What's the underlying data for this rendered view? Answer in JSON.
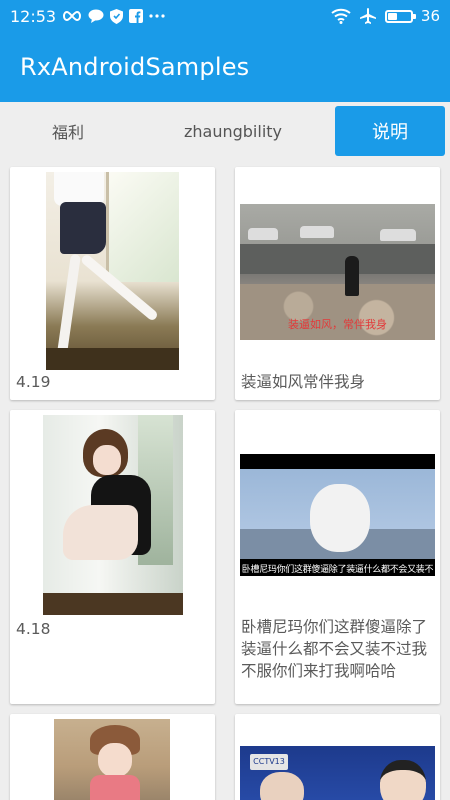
{
  "status_bar": {
    "time": "12:53",
    "battery": "36",
    "battery_level": 0.36,
    "left_icons": [
      "infinity-icon",
      "chat-bubble-icon",
      "shield-icon",
      "facebook-icon",
      "more-dots-icon"
    ],
    "right_icons": [
      "wifi-icon",
      "airplane-icon",
      "battery-icon"
    ]
  },
  "app_bar": {
    "title": "RxAndroidSamples",
    "background": "#1a9be8"
  },
  "tabs": [
    {
      "label": "福利",
      "selected": false
    },
    {
      "label": "zhaungbility",
      "selected": false
    },
    {
      "label": "说明",
      "selected": true
    }
  ],
  "cards": [
    {
      "caption": "4.19",
      "image": "photo-girl-skirt"
    },
    {
      "caption": "装逼如风常伴我身",
      "image": "photo-street-gif",
      "image_caption": "装逼如风，常伴我身"
    },
    {
      "caption": "4.18",
      "image": "photo-girl-sitting"
    },
    {
      "caption": "卧槽尼玛你们这群傻逼除了装逼什么都不会又装不过我不服你们来打我啊哈哈",
      "image": "photo-meme",
      "image_caption": "卧槽尼玛你们这群傻逼除了装逼什么都不会又装不过我不服你们来打我啊哈哈"
    },
    {
      "caption": "",
      "image": "photo-girl-pink"
    },
    {
      "caption": "",
      "image": "photo-tv-broadcast",
      "image_caption": "CCTV13"
    }
  ],
  "colors": {
    "primary": "#1a9be8",
    "background": "#eeeeee",
    "card": "#ffffff",
    "caption_text": "#5a5a5a"
  }
}
